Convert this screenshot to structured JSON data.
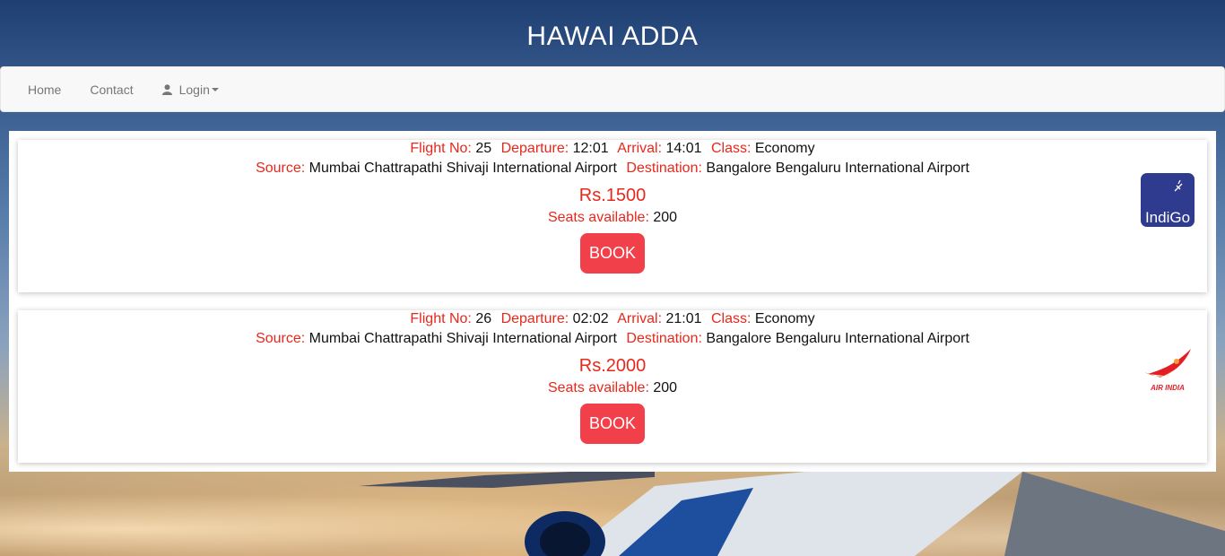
{
  "site": {
    "title": "HAWAI ADDA"
  },
  "nav": {
    "home": "Home",
    "contact": "Contact",
    "login": "Login"
  },
  "labels": {
    "flight_no": "Flight No:",
    "departure": "Departure:",
    "arrival": "Arrival:",
    "class": "Class:",
    "source": "Source:",
    "destination": "Destination:",
    "seats": "Seats available:"
  },
  "flights": [
    {
      "flight_no": "25",
      "departure": "12:01",
      "arrival": "14:01",
      "class": "Economy",
      "source": "Mumbai Chattrapathi Shivaji International Airport",
      "destination": "Bangalore Bengaluru International Airport",
      "price": "Rs.1500",
      "seats": "200",
      "book_label": "BOOK",
      "airline_logo": "indigo-logo",
      "logo_text": "IndiGo"
    },
    {
      "flight_no": "26",
      "departure": "02:02",
      "arrival": "21:01",
      "class": "Economy",
      "source": "Mumbai Chattrapathi Shivaji International Airport",
      "destination": "Bangalore Bengaluru International Airport",
      "price": "Rs.2000",
      "seats": "200",
      "book_label": "BOOK",
      "airline_logo": "air-india-logo",
      "logo_text": "AIR INDIA"
    }
  ],
  "colors": {
    "accent_red": "#e8281c",
    "button_red": "#f2404a",
    "navbar_bg": "#f8f8f8",
    "indigo_blue": "#2e3b8e"
  }
}
